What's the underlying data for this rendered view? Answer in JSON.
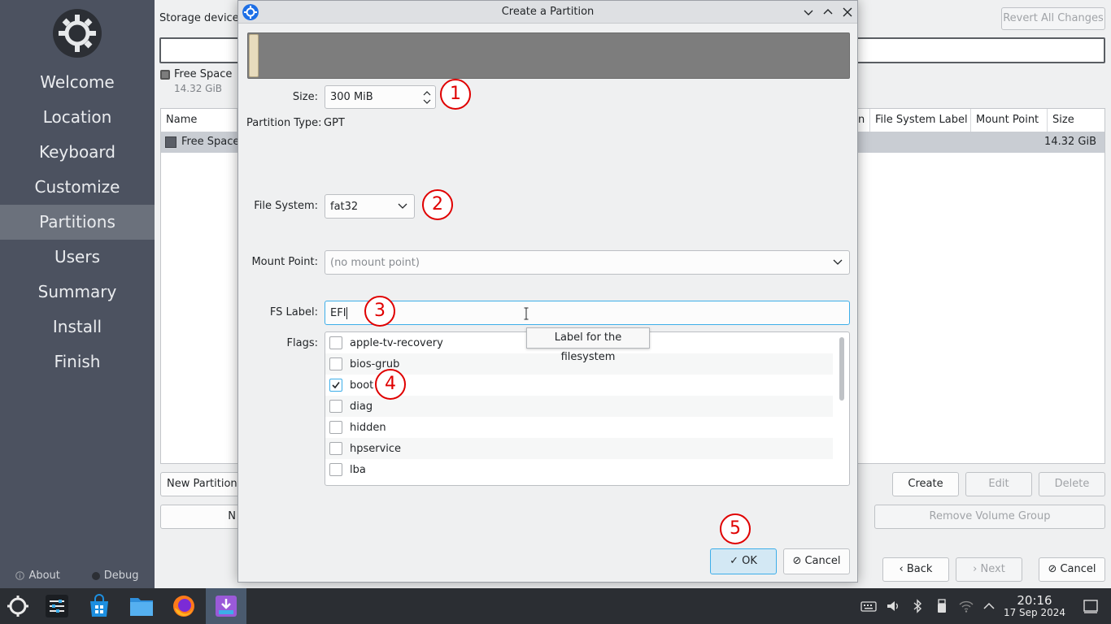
{
  "sidebar": {
    "items": [
      "Welcome",
      "Location",
      "Keyboard",
      "Customize",
      "Partitions",
      "Users",
      "Summary",
      "Install",
      "Finish"
    ],
    "about": "About",
    "debug": "Debug"
  },
  "main": {
    "storage_label": "Storage device:",
    "revert": "Revert All Changes",
    "legend_label": "Free Space",
    "legend_size": "14.32 GiB",
    "columns": [
      "Name",
      "File System Label",
      "Mount Point",
      "Size"
    ],
    "col_frag": "n",
    "row": {
      "name": "Free Space",
      "size": "14.32 GiB"
    },
    "new_partition": "New Partition",
    "frag_n": "N",
    "create": "Create",
    "edit": "Edit",
    "delete": "Delete",
    "remove_vg": "Remove Volume Group",
    "back": "Back",
    "next": "Next",
    "cancel": "Cancel"
  },
  "dialog": {
    "title": "Create a Partition",
    "size_label": "Size:",
    "size_value": "300 MiB",
    "ptype_label": "Partition Type:",
    "ptype_value": "GPT",
    "fs_label": "File System:",
    "fs_value": "fat32",
    "mount_label": "Mount Point:",
    "mount_placeholder": "(no mount point)",
    "fslabel_label": "FS Label:",
    "fslabel_value": "EFI",
    "flags_label": "Flags:",
    "flags": [
      {
        "name": "apple-tv-recovery",
        "checked": false
      },
      {
        "name": "bios-grub",
        "checked": false
      },
      {
        "name": "boot",
        "checked": true
      },
      {
        "name": "diag",
        "checked": false
      },
      {
        "name": "hidden",
        "checked": false
      },
      {
        "name": "hpservice",
        "checked": false
      },
      {
        "name": "lba",
        "checked": false
      }
    ],
    "tooltip": "Label for the filesystem",
    "ok": "OK",
    "cancel": "Cancel"
  },
  "markers": [
    "1",
    "2",
    "3",
    "4",
    "5"
  ],
  "taskbar": {
    "time": "20:16",
    "date": "17 Sep 2024"
  },
  "colors": {
    "sidebar_bg": "#4c5260",
    "active_nav": "#6b717c",
    "accent": "#3daee9",
    "marker": "#e00000"
  }
}
